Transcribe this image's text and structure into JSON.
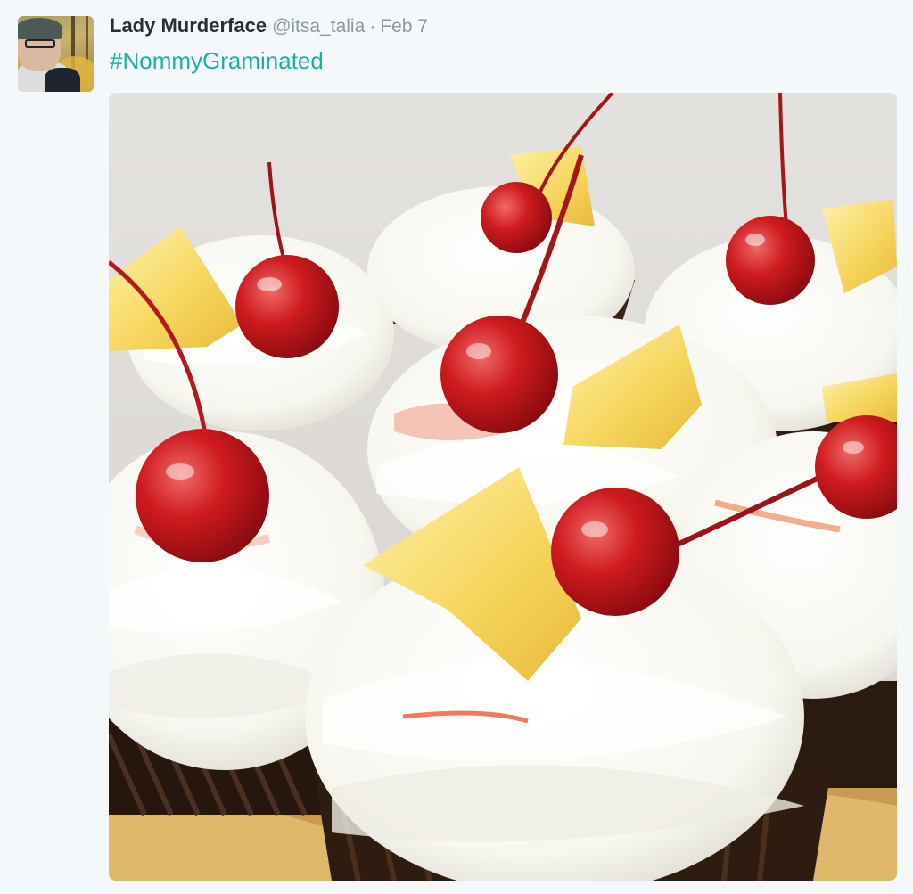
{
  "tweet": {
    "display_name": "Lady Murderface",
    "handle": "@itsa_talia",
    "separator": "·",
    "timestamp": "Feb 7",
    "text": "#NommyGraminated"
  },
  "colors": {
    "background": "#f5f8fa",
    "name": "#292f33",
    "meta": "#8899a6",
    "hashtag": "#1faea6"
  },
  "media": {
    "icons": [
      "avatar-photo",
      "cupcakes-photo"
    ]
  }
}
